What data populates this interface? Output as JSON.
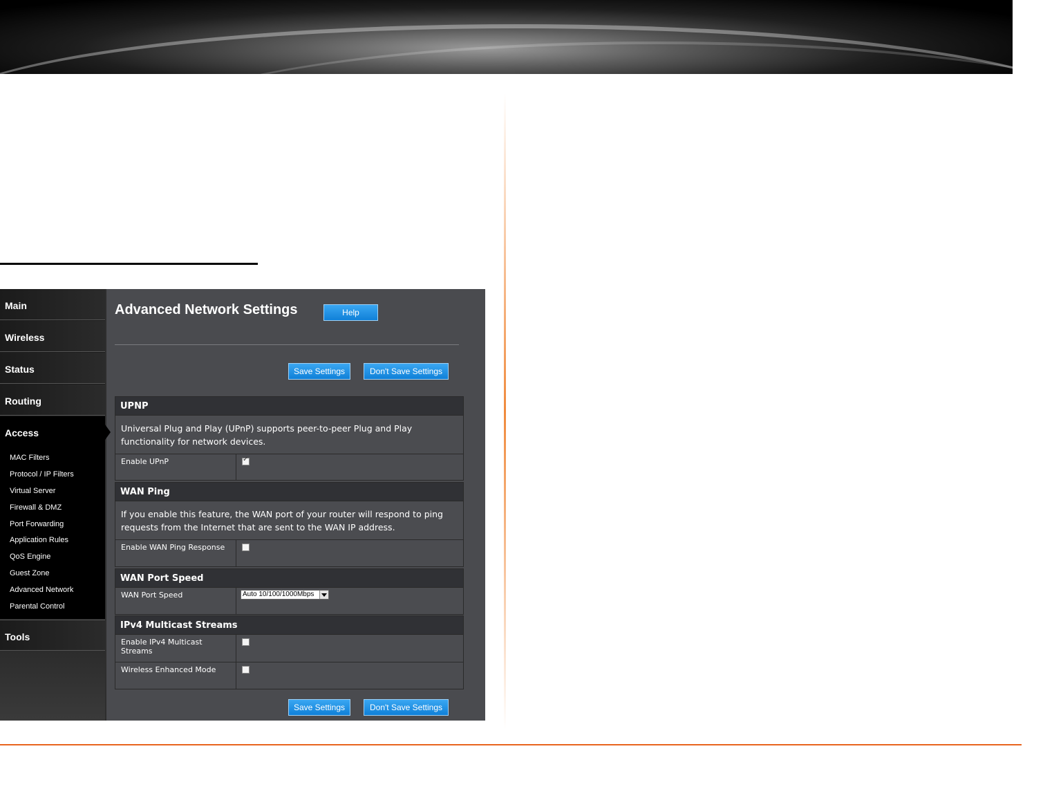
{
  "sidebar": {
    "items": [
      "Main",
      "Wireless",
      "Status",
      "Routing",
      "Access",
      "Tools"
    ],
    "sub_items": [
      "MAC Filters",
      "Protocol / IP Filters",
      "Virtual Server",
      "Firewall & DMZ",
      "Port Forwarding",
      "Application Rules",
      "QoS Engine",
      "Guest Zone",
      "Advanced Network",
      "Parental Control"
    ]
  },
  "page": {
    "title": "Advanced Network Settings",
    "help_label": "Help",
    "save_label": "Save Settings",
    "dont_save_label": "Don't Save Settings"
  },
  "upnp": {
    "header": "UPNP",
    "description": "Universal Plug and Play (UPnP) supports peer-to-peer Plug and Play functionality for network devices.",
    "enable_label": "Enable UPnP",
    "enabled": true
  },
  "wan_ping": {
    "header": "WAN Ping",
    "description": "If you enable this feature, the WAN port of your router will respond to ping requests from the Internet that are sent to the WAN IP address.",
    "enable_label": "Enable WAN Ping Response",
    "enabled": false
  },
  "wan_port_speed": {
    "header": "WAN Port Speed",
    "label": "WAN Port Speed",
    "selected": "Auto 10/100/1000Mbps"
  },
  "multicast": {
    "header": "IPv4 Multicast Streams",
    "enable_label": "Enable IPv4 Multicast Streams",
    "enabled": false,
    "wireless_label": "Wireless Enhanced Mode",
    "wireless_enabled": false
  }
}
